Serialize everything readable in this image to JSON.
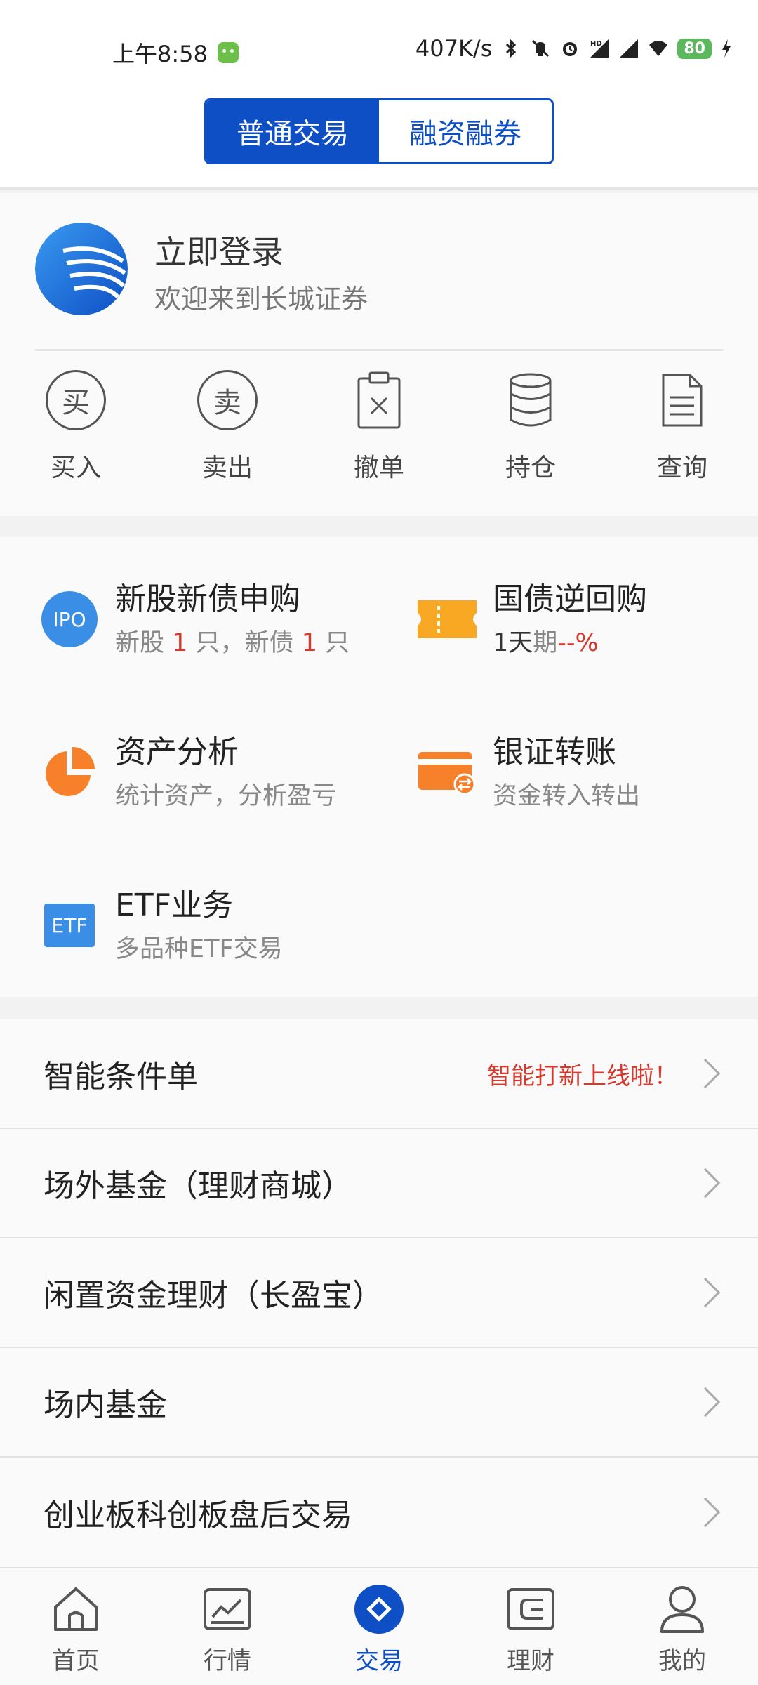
{
  "status_bar": {
    "time": "上午8:58",
    "net_speed": "407K/s",
    "signal_hd": "HD",
    "battery": "80"
  },
  "header": {
    "tabs": [
      {
        "label": "普通交易",
        "active": true
      },
      {
        "label": "融资融券",
        "active": false
      }
    ]
  },
  "login": {
    "title": "立即登录",
    "subtitle": "欢迎来到长城证券"
  },
  "quick_actions": [
    {
      "label": "买入",
      "glyph": "买",
      "icon": "buy-icon"
    },
    {
      "label": "卖出",
      "glyph": "卖",
      "icon": "sell-icon"
    },
    {
      "label": "撤单",
      "icon": "cancel-order-icon"
    },
    {
      "label": "持仓",
      "icon": "holdings-icon"
    },
    {
      "label": "查询",
      "icon": "query-icon"
    }
  ],
  "services": {
    "ipo": {
      "title": "新股新债申购",
      "icon_text": "IPO",
      "sub_a": "新股 ",
      "sub_b": "1",
      "sub_c": " 只，新债 ",
      "sub_d": "1",
      "sub_e": " 只"
    },
    "repo": {
      "title": "国债逆回购",
      "sub_a": "1天",
      "sub_b": "期",
      "sub_c": "--%"
    },
    "asset": {
      "title": "资产分析",
      "sub": "统计资产，分析盈亏"
    },
    "transfer": {
      "title": "银证转账",
      "sub": "资金转入转出"
    },
    "etf": {
      "title": "ETF业务",
      "icon_text": "ETF",
      "sub": "多品种ETF交易"
    }
  },
  "list": [
    {
      "label": "智能条件单",
      "tag": "智能打新上线啦！"
    },
    {
      "label": "场外基金（理财商城）",
      "tag": ""
    },
    {
      "label": "闲置资金理财（长盈宝）",
      "tag": ""
    },
    {
      "label": "场内基金",
      "tag": ""
    },
    {
      "label": "创业板科创板盘后交易",
      "tag": ""
    }
  ],
  "bottom_nav": [
    {
      "label": "首页",
      "icon": "home-icon",
      "active": false
    },
    {
      "label": "行情",
      "icon": "market-icon",
      "active": false
    },
    {
      "label": "交易",
      "icon": "trade-icon",
      "active": true
    },
    {
      "label": "理财",
      "icon": "wealth-icon",
      "active": false
    },
    {
      "label": "我的",
      "icon": "profile-icon",
      "active": false
    }
  ],
  "colors": {
    "primary": "#0e4fc5",
    "accent_red": "#d9372b",
    "ipo_blue": "#3a8ee6",
    "orange": "#f7812a",
    "yellow": "#f8a823"
  }
}
